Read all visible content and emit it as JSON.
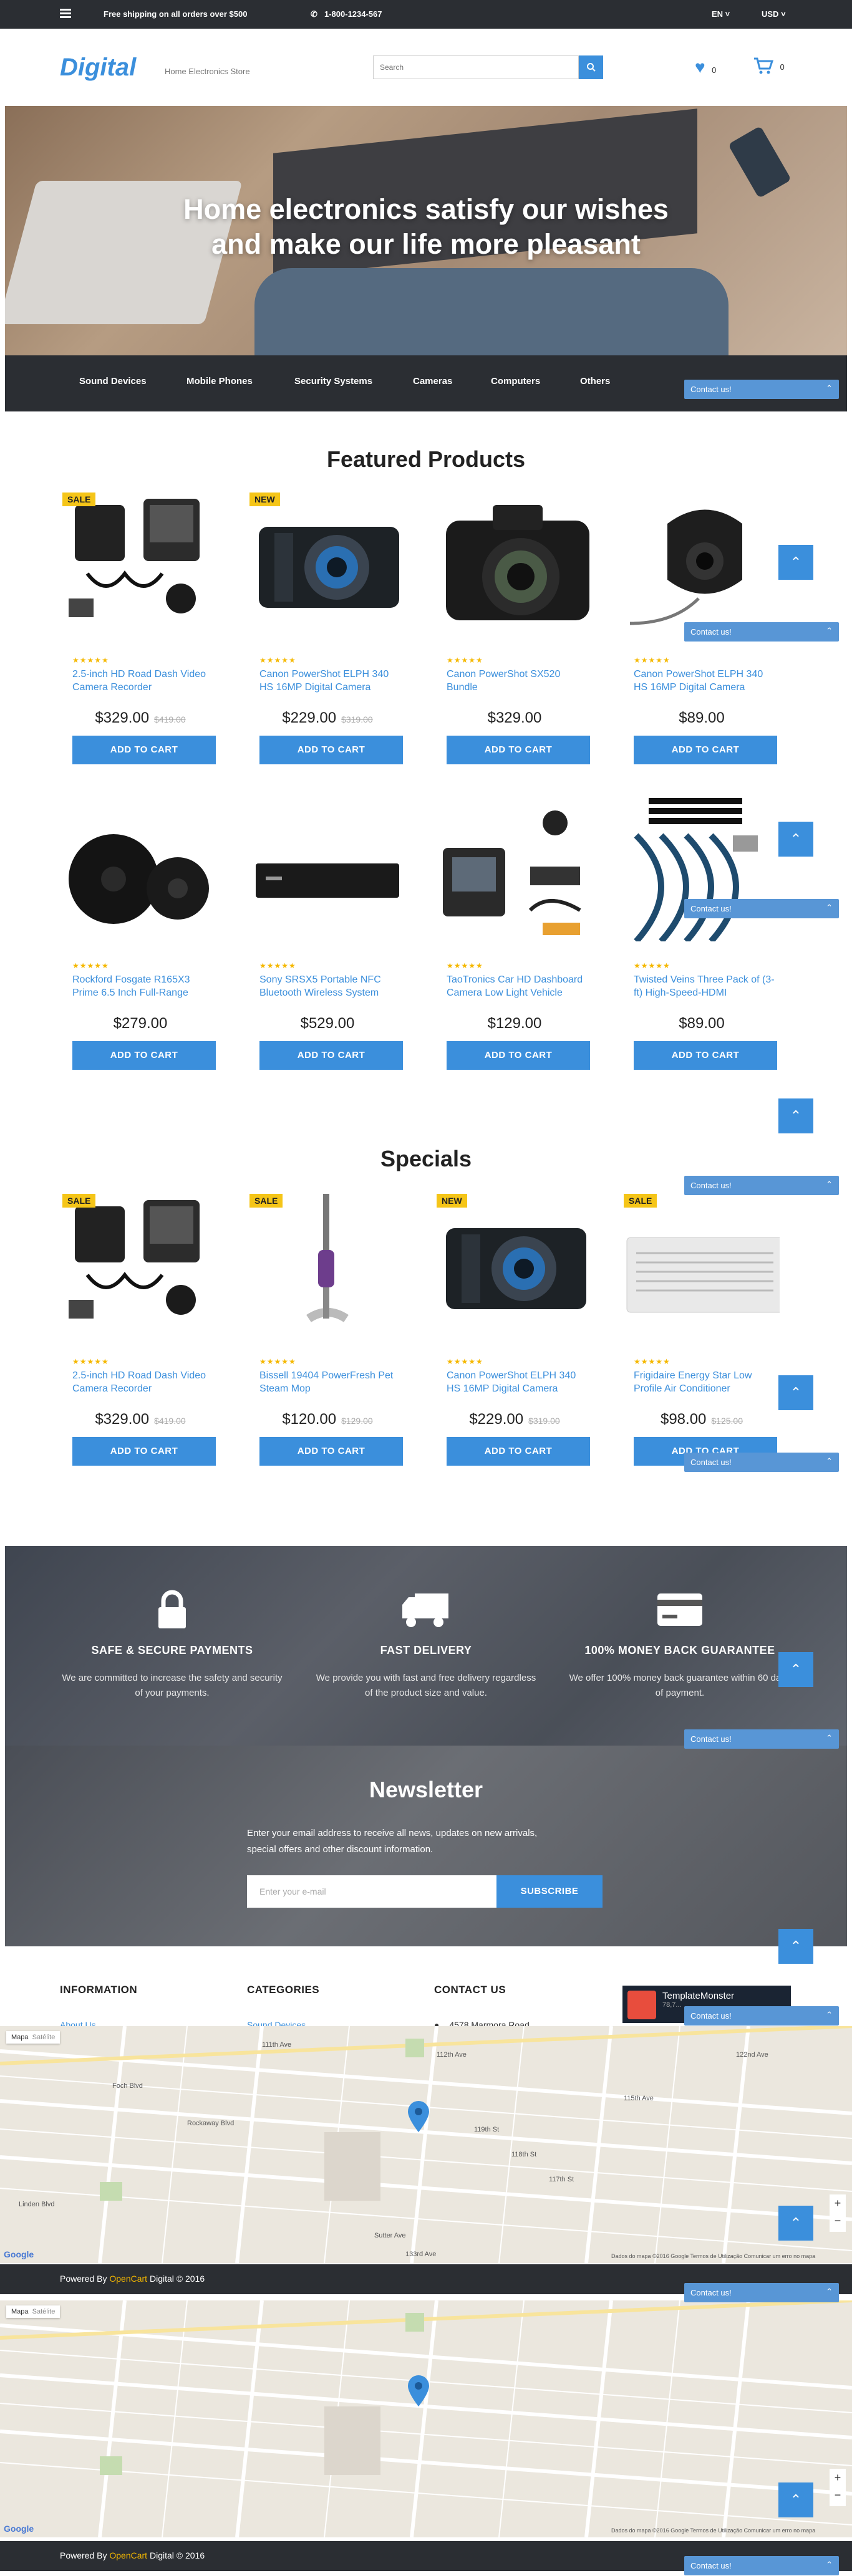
{
  "topbar": {
    "shipping": "Free shipping on all orders over $500",
    "phone": "1-800-1234-567",
    "language": "EN",
    "currency": "USD"
  },
  "header": {
    "logo": "Digital",
    "tagline": "Home Electronics Store",
    "search_placeholder": "Search",
    "wishlist_count": "0",
    "cart_count": "0"
  },
  "hero": {
    "line1": "Home electronics satisfy our wishes",
    "line2": "and make our life more pleasant"
  },
  "nav": {
    "items": [
      "Sound Devices",
      "Mobile Phones",
      "Security Systems",
      "Cameras",
      "Computers",
      "Others"
    ]
  },
  "contact_label": "Contact us!",
  "featured": {
    "title": "Featured Products",
    "products": [
      {
        "badge": "SALE",
        "name": "2.5-inch HD Road Dash Video Camera Recorder",
        "price": "$329.00",
        "old_price": "$419.00",
        "cta": "ADD TO CART"
      },
      {
        "badge": "NEW",
        "name": "Canon PowerShot ELPH 340 HS 16MP Digital Camera",
        "price": "$229.00",
        "old_price": "$319.00",
        "cta": "ADD TO CART"
      },
      {
        "badge": "",
        "name": "Canon PowerShot SX520 Bundle",
        "price": "$329.00",
        "old_price": "",
        "cta": "ADD TO CART"
      },
      {
        "badge": "",
        "name": "Canon PowerShot ELPH 340 HS 16MP Digital Camera",
        "price": "$89.00",
        "old_price": "",
        "cta": "ADD TO CART"
      },
      {
        "badge": "",
        "name": "Rockford Fosgate R165X3 Prime 6.5 Inch Full-Range",
        "price": "$279.00",
        "old_price": "",
        "cta": "ADD TO CART"
      },
      {
        "badge": "",
        "name": "Sony SRSX5 Portable NFC Bluetooth Wireless System",
        "price": "$529.00",
        "old_price": "",
        "cta": "ADD TO CART"
      },
      {
        "badge": "",
        "name": "TaoTronics Car HD Dashboard Camera Low Light Vehicle",
        "price": "$129.00",
        "old_price": "",
        "cta": "ADD TO CART"
      },
      {
        "badge": "",
        "name": "Twisted Veins Three Pack of (3-ft) High-Speed-HDMI",
        "price": "$89.00",
        "old_price": "",
        "cta": "ADD TO CART"
      }
    ]
  },
  "specials": {
    "title": "Specials",
    "products": [
      {
        "badge": "SALE",
        "name": "2.5-inch HD Road Dash Video Camera Recorder",
        "price": "$329.00",
        "old_price": "$419.00",
        "cta": "ADD TO CART"
      },
      {
        "badge": "SALE",
        "name": "Bissell 19404 PowerFresh Pet Steam Mop",
        "price": "$120.00",
        "old_price": "$129.00",
        "cta": "ADD TO CART"
      },
      {
        "badge": "NEW",
        "name": "Canon PowerShot ELPH 340 HS 16MP Digital Camera",
        "price": "$229.00",
        "old_price": "$319.00",
        "cta": "ADD TO CART"
      },
      {
        "badge": "SALE",
        "name": "Frigidaire Energy Star Low Profile Air Conditioner",
        "price": "$98.00",
        "old_price": "$125.00",
        "cta": "ADD TO CART"
      }
    ]
  },
  "features": [
    {
      "title": "SAFE & SECURE PAYMENTS",
      "text": "We are committed to increase the safety and security of your payments."
    },
    {
      "title": "FAST DELIVERY",
      "text": "We provide you with fast and free delivery regardless of the product size and value."
    },
    {
      "title": "100% MONEY BACK GUARANTEE",
      "text": "We offer 100% money back guarantee within 60 days of payment."
    }
  ],
  "newsletter": {
    "title": "Newsletter",
    "text": "Enter your email address to receive all news, updates on new arrivals, special offers and other discount information.",
    "placeholder": "Enter your e-mail",
    "button": "SUBSCRIBE"
  },
  "footer": {
    "information": "INFORMATION",
    "categories": "CATEGORIES",
    "contact": "CONTACT US",
    "about_link": "About Us",
    "sound_link": "Sound Devices",
    "address": "4578 Marmora Road",
    "tm_label": "TemplateMonster",
    "tm_sub": "78,7..."
  },
  "map": {
    "type_map": "Mapa",
    "type_sat": "Satélite",
    "google": "Google",
    "attribution": "Dados do mapa ©2016 Google   Termos de Utilização   Comunicar um erro no mapa",
    "streets": [
      "111th Ave",
      "112th Ave",
      "115th Ave",
      "Linden Blvd",
      "Sutter Ave",
      "122nd Ave",
      "119th St",
      "118th St",
      "117th St",
      "Rockaway Blvd",
      "Foch Blvd",
      "133rd Ave"
    ]
  },
  "copyright": {
    "prefix": "Powered By",
    "brand": "OpenCart",
    "suffix": "Digital © 2016"
  }
}
